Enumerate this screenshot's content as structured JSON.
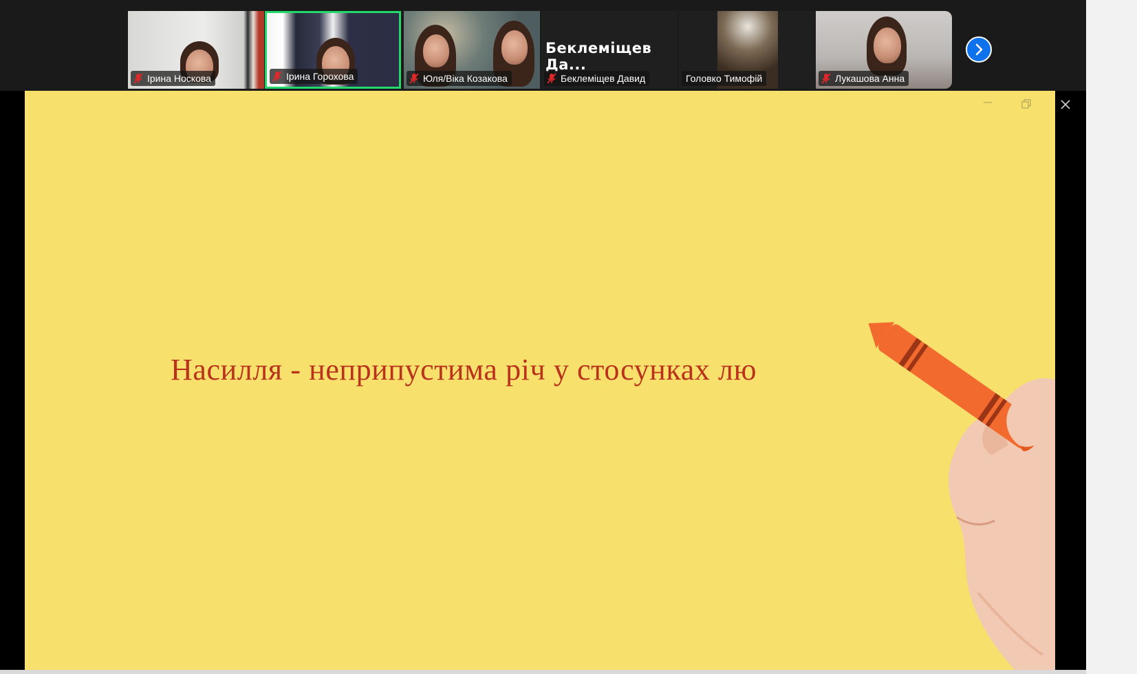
{
  "participants": [
    {
      "name": "Ірина Носкова",
      "muted": true
    },
    {
      "name": "Ірина Горохова",
      "muted": true,
      "active_speaker": true
    },
    {
      "name": "Юля/Віка Козакова",
      "muted": true
    },
    {
      "name": "Беклеміщев Давид",
      "muted": true,
      "display_title": "Беклеміщев  Да..."
    },
    {
      "name": "Головко Тимофій",
      "muted": false
    },
    {
      "name": "Лукашова Анна",
      "muted": true
    }
  ],
  "slide": {
    "text": "Насилля - неприпустима річ у стосунках лю"
  },
  "colors": {
    "active_border": "#23d96b",
    "slide_background": "#f8e06c",
    "slide_text": "#b8321c",
    "next_button": "#0e72ed",
    "muted_mic": "#e02828"
  },
  "icons": {
    "muted": "mic-muted-icon",
    "next": "chevron-right-icon",
    "minimize": "minimize-icon",
    "restore": "restore-icon",
    "close": "close-icon"
  }
}
